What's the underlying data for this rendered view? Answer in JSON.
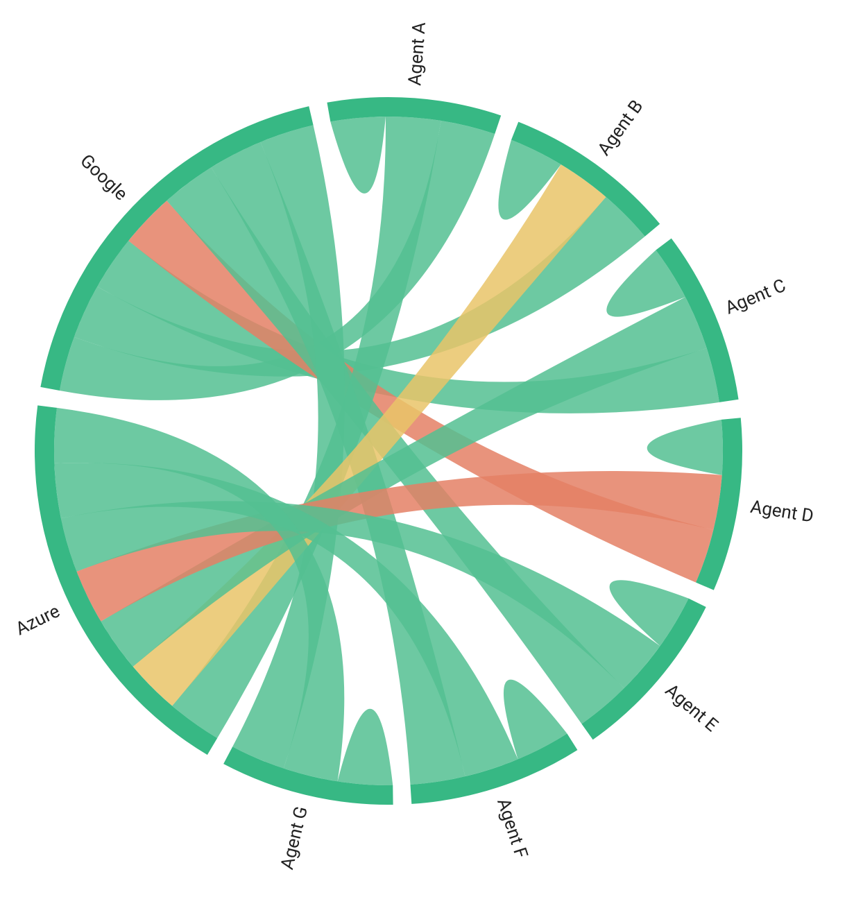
{
  "chart_data": {
    "type": "chord",
    "title": "",
    "nodes": [
      {
        "id": "agentA",
        "label": "Agent A"
      },
      {
        "id": "agentB",
        "label": "Agent B"
      },
      {
        "id": "agentC",
        "label": "Agent C"
      },
      {
        "id": "agentD",
        "label": "Agent D"
      },
      {
        "id": "agentE",
        "label": "Agent E"
      },
      {
        "id": "agentF",
        "label": "Agent F"
      },
      {
        "id": "agentG",
        "label": "Agent G"
      },
      {
        "id": "azure",
        "label": "Azure"
      },
      {
        "id": "google",
        "label": "Google"
      }
    ],
    "links": [
      {
        "source": "google",
        "target": "agentA",
        "value": 10,
        "color": "green"
      },
      {
        "source": "google",
        "target": "agentB",
        "value": 10,
        "color": "green"
      },
      {
        "source": "google",
        "target": "agentC",
        "value": 10,
        "color": "green"
      },
      {
        "source": "google",
        "target": "agentD",
        "value": 10,
        "color": "orange"
      },
      {
        "source": "google",
        "target": "agentE",
        "value": 10,
        "color": "green"
      },
      {
        "source": "google",
        "target": "agentF",
        "value": 10,
        "color": "green"
      },
      {
        "source": "google",
        "target": "agentG",
        "value": 10,
        "color": "green"
      },
      {
        "source": "azure",
        "target": "agentA",
        "value": 10,
        "color": "green"
      },
      {
        "source": "azure",
        "target": "agentB",
        "value": 10,
        "color": "yellow"
      },
      {
        "source": "azure",
        "target": "agentC",
        "value": 10,
        "color": "green"
      },
      {
        "source": "azure",
        "target": "agentD",
        "value": 10,
        "color": "orange"
      },
      {
        "source": "azure",
        "target": "agentE",
        "value": 10,
        "color": "green"
      },
      {
        "source": "azure",
        "target": "agentF",
        "value": 10,
        "color": "green"
      },
      {
        "source": "azure",
        "target": "agentG",
        "value": 10,
        "color": "green"
      },
      {
        "source": "agentA",
        "target": "agentA",
        "value": 5,
        "color": "green"
      },
      {
        "source": "agentB",
        "target": "agentB",
        "value": 5,
        "color": "green"
      },
      {
        "source": "agentC",
        "target": "agentC",
        "value": 5,
        "color": "green"
      },
      {
        "source": "agentD",
        "target": "agentD",
        "value": 5,
        "color": "green"
      },
      {
        "source": "agentE",
        "target": "agentE",
        "value": 5,
        "color": "green"
      },
      {
        "source": "agentF",
        "target": "agentF",
        "value": 5,
        "color": "green"
      },
      {
        "source": "agentG",
        "target": "agentG",
        "value": 5,
        "color": "green"
      }
    ],
    "colors": {
      "arc": "#37b884",
      "green": "#53c092",
      "yellow": "#e9c468",
      "orange": "#e48065"
    },
    "ribbon_opacity": 0.85,
    "pad_degrees": 3,
    "start_angle_deg": -10,
    "outer_radius": 510,
    "arc_width": 28,
    "label_offset": 18
  }
}
